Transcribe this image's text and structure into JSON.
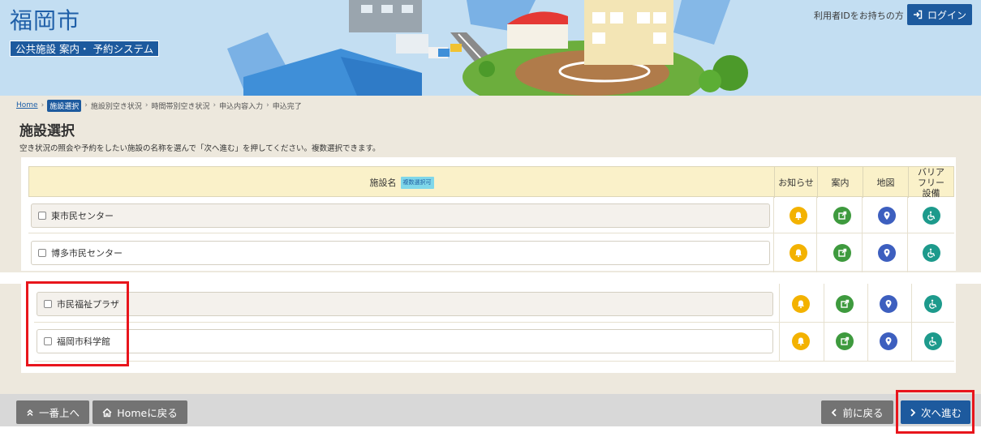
{
  "header": {
    "city_name": "福岡市",
    "system_name": "公共施設 案内・ 予約システム",
    "id_holder_text": "利用者IDをお持ちの方",
    "login_label": "ログイン",
    "brand_color": "#1d5a9e"
  },
  "breadcrumb": {
    "home": "Home",
    "steps": [
      "施設選択",
      "施設別空き状況",
      "時間帯別空き状況",
      "申込内容入力",
      "申込完了"
    ],
    "current_index": 0
  },
  "page": {
    "title": "施設選択",
    "description": "空き状況の照会や予約をしたい施設の名称を選んで「次へ進む」を押してください。複数選択できます。"
  },
  "table": {
    "headers": {
      "name": "施設名",
      "multi_badge": "複数選択可",
      "notice": "お知らせ",
      "guide": "案内",
      "map": "地図",
      "barrier_free": "バリアフリー設備"
    },
    "rows": [
      {
        "name": "東市民センター"
      },
      {
        "name": "博多市民センター"
      },
      {
        "name": "市民福祉プラザ"
      },
      {
        "name": "福岡市科学館"
      }
    ],
    "icons": {
      "notice": "bell-icon",
      "guide": "external-link-icon",
      "map": "map-pin-icon",
      "barrier_free": "wheelchair-icon"
    },
    "icon_colors": {
      "notice": "#f3b200",
      "guide": "#3e9a3e",
      "map": "#3d5fbf",
      "barrier_free": "#1d9a8c"
    }
  },
  "footer": {
    "top_label": "一番上へ",
    "home_label": "Homeに戻る",
    "prev_label": "前に戻る",
    "next_label": "次へ進む"
  }
}
